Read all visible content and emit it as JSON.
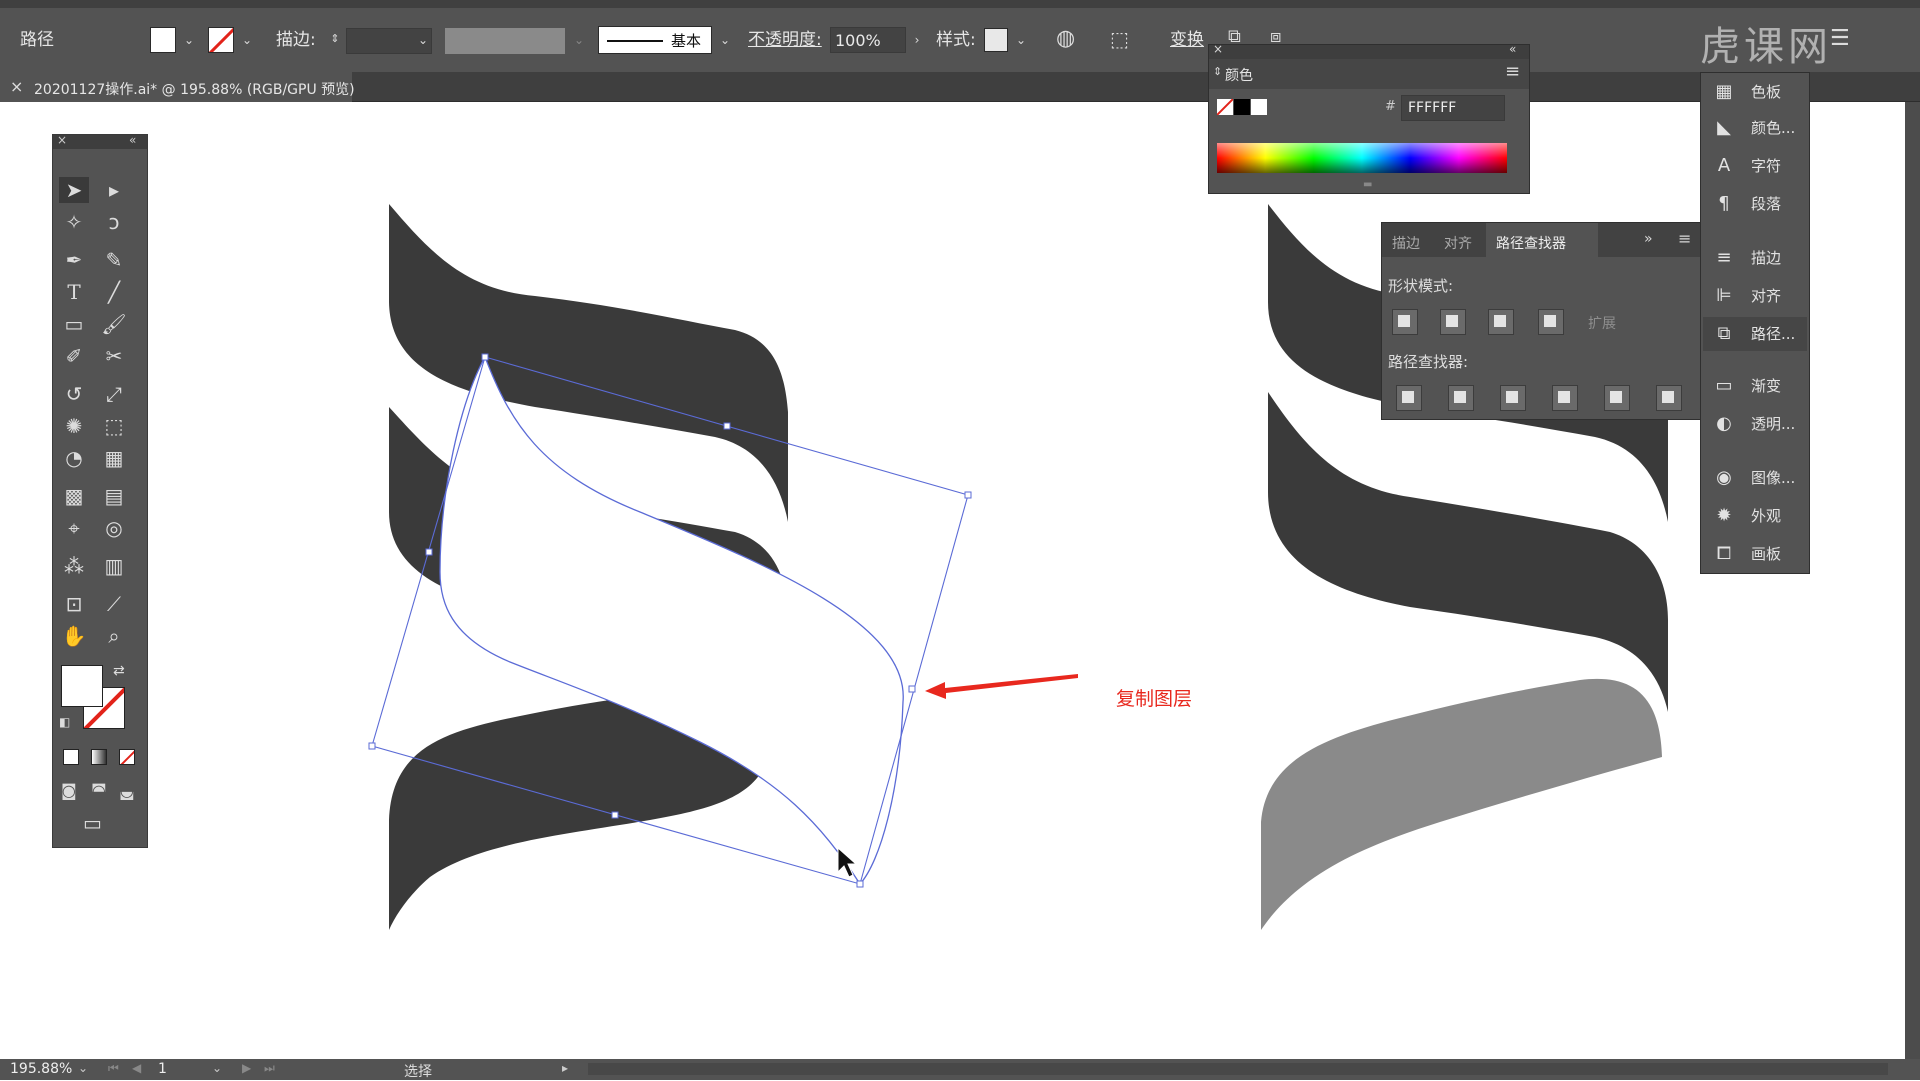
{
  "control_bar": {
    "object_type": "路径",
    "stroke_label": "描边:",
    "stroke_profile": "基本",
    "opacity_label": "不透明度:",
    "opacity_value": "100%",
    "style_label": "样式:",
    "transform_label": "变换"
  },
  "document_tab": {
    "close": "×",
    "title": "20201127操作.ai* @ 195.88% (RGB/GPU 预览)"
  },
  "watermark": "虎课网",
  "color_panel": {
    "title": "颜色",
    "hex_symbol": "#",
    "hex_value": "FFFFFF"
  },
  "pathfinder_panel": {
    "tabs": [
      "描边",
      "对齐",
      "路径查找器"
    ],
    "active_tab": "路径查找器",
    "shape_modes_label": "形状模式:",
    "expand_label": "扩展",
    "pathfinders_label": "路径查找器:"
  },
  "right_dock": {
    "items": [
      {
        "icon": "swatches-icon",
        "label": "色板"
      },
      {
        "icon": "color-guide-icon",
        "label": "颜色..."
      },
      {
        "icon": "character-icon",
        "label": "字符"
      },
      {
        "icon": "paragraph-icon",
        "label": "段落"
      },
      {
        "icon": "stroke-icon",
        "label": "描边"
      },
      {
        "icon": "align-icon",
        "label": "对齐"
      },
      {
        "icon": "pathfinder-icon",
        "label": "路径..."
      },
      {
        "icon": "gradient-icon",
        "label": "渐变"
      },
      {
        "icon": "transparency-icon",
        "label": "透明..."
      },
      {
        "icon": "image-trace-icon",
        "label": "图像..."
      },
      {
        "icon": "appearance-icon",
        "label": "外观"
      },
      {
        "icon": "artboards-icon",
        "label": "画板"
      }
    ]
  },
  "annotation": {
    "text": "复制图层",
    "color": "#e8281e"
  },
  "colors": {
    "shape_dark": "#3a3a3a",
    "shape_gray": "#8a8a8a",
    "selection": "#5b6bd6",
    "ui_panel": "#535353"
  },
  "status_bar": {
    "zoom": "195.88%",
    "artboard_number": "1",
    "mode": "选择"
  }
}
